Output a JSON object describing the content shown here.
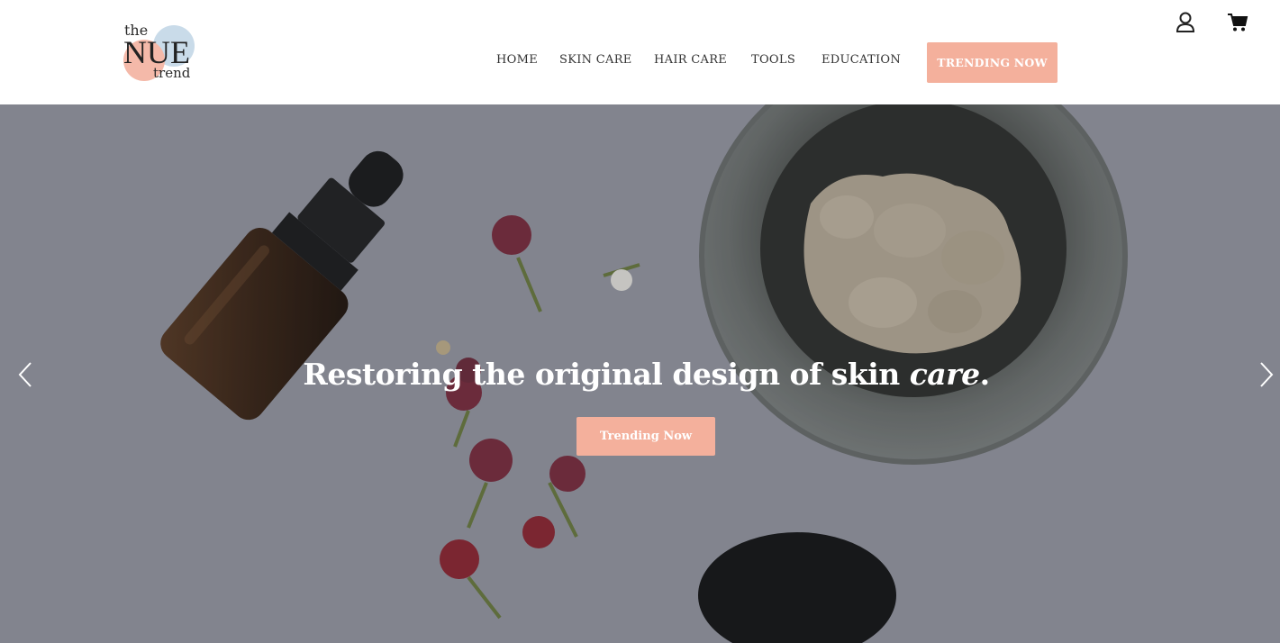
{
  "brand": {
    "logo_top": "the",
    "logo_main": "NUE",
    "logo_bottom": "trend",
    "colors": {
      "accent": "#f4b09c",
      "logo_blue": "#c9dbe9",
      "logo_pink": "#f4b9a9"
    }
  },
  "nav": {
    "items": [
      {
        "label": "HOME"
      },
      {
        "label": "SKIN CARE"
      },
      {
        "label": "HAIR CARE"
      },
      {
        "label": "TOOLS"
      },
      {
        "label": "EDUCATION"
      }
    ],
    "cta_label": "TRENDING NOW"
  },
  "icons": {
    "account": "user-icon",
    "cart": "cart-icon",
    "prev": "chevron-left-icon",
    "next": "chevron-right-icon"
  },
  "hero": {
    "title_main": "Restoring the original design of skin ",
    "title_emphasis": "care",
    "title_end": ".",
    "button_label": "Trending Now"
  }
}
